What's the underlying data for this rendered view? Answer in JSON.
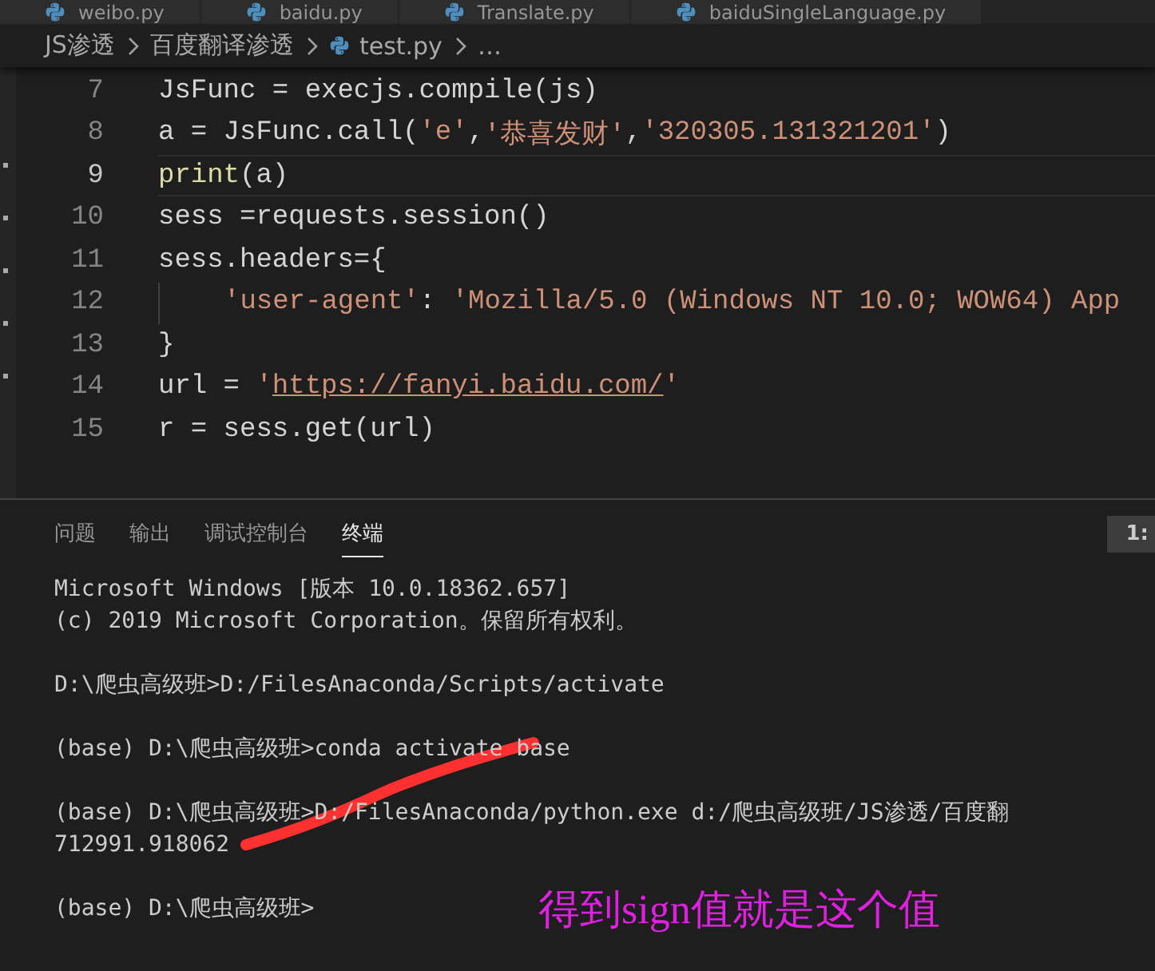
{
  "editor_tabs": [
    {
      "label": "weibo.py",
      "selected": false
    },
    {
      "label": "baidu.py",
      "selected": false
    },
    {
      "label": "Translate.py",
      "selected": false
    },
    {
      "label": "baiduSingleLanguage.py",
      "selected": false
    }
  ],
  "breadcrumb": [
    {
      "label": "JS渗透",
      "kind": "folder"
    },
    {
      "label": "百度翻译渗透",
      "kind": "folder"
    },
    {
      "label": "test.py",
      "kind": "file"
    },
    {
      "label": "…",
      "kind": "more"
    }
  ],
  "code_lines": [
    {
      "number": "7",
      "current": false,
      "segments": [
        {
          "text": "JsFunc = execjs.compile(js)",
          "kind": "plain"
        }
      ]
    },
    {
      "number": "8",
      "current": false,
      "segments": [
        {
          "text": "a = JsFunc.call(",
          "kind": "plain"
        },
        {
          "text": "'e'",
          "kind": "string"
        },
        {
          "text": ",",
          "kind": "plain"
        },
        {
          "text": "'恭喜发财'",
          "kind": "string"
        },
        {
          "text": ",",
          "kind": "plain"
        },
        {
          "text": "'320305.131321201'",
          "kind": "string"
        },
        {
          "text": ")",
          "kind": "plain"
        }
      ]
    },
    {
      "number": "9",
      "current": true,
      "segments": [
        {
          "text": "print",
          "kind": "function"
        },
        {
          "text": "(a)",
          "kind": "plain"
        }
      ]
    },
    {
      "number": "10",
      "current": false,
      "segments": [
        {
          "text": "sess =requests.session()",
          "kind": "plain"
        }
      ]
    },
    {
      "number": "11",
      "current": false,
      "segments": [
        {
          "text": "sess.headers={",
          "kind": "plain"
        }
      ]
    },
    {
      "number": "12",
      "current": false,
      "indent_guide": true,
      "segments": [
        {
          "text": "'user-agent'",
          "kind": "string"
        },
        {
          "text": ": ",
          "kind": "plain"
        },
        {
          "text": "'Mozilla/5.0 (Windows NT 10.0; WOW64) App",
          "kind": "string"
        }
      ]
    },
    {
      "number": "13",
      "current": false,
      "segments": [
        {
          "text": "}",
          "kind": "plain"
        }
      ]
    },
    {
      "number": "14",
      "current": false,
      "segments": [
        {
          "text": "url = ",
          "kind": "plain"
        },
        {
          "text": "'",
          "kind": "string"
        },
        {
          "text": "https://fanyi.baidu.com/",
          "kind": "link"
        },
        {
          "text": "'",
          "kind": "string"
        }
      ]
    },
    {
      "number": "15",
      "current": false,
      "segments": [
        {
          "text": "r = sess.get(url)",
          "kind": "plain"
        }
      ]
    }
  ],
  "panel_tabs": [
    {
      "label": "问题",
      "selected": false
    },
    {
      "label": "输出",
      "selected": false
    },
    {
      "label": "调试控制台",
      "selected": false
    },
    {
      "label": "终端",
      "selected": true
    }
  ],
  "terminal_selector": "1:",
  "terminal_blocks": [
    [
      "Microsoft Windows [版本 10.0.18362.657]",
      "(c) 2019 Microsoft Corporation。保留所有权利。"
    ],
    [
      "D:\\爬虫高级班>D:/FilesAnaconda/Scripts/activate"
    ],
    [
      "(base) D:\\爬虫高级班>conda activate base"
    ],
    [
      "(base) D:\\爬虫高级班>D:/FilesAnaconda/python.exe d:/爬虫高级班/JS渗透/百度翻",
      "712991.918062"
    ],
    [
      "(base) D:\\爬虫高级班>"
    ]
  ],
  "annotation": "得到sign值就是这个值"
}
